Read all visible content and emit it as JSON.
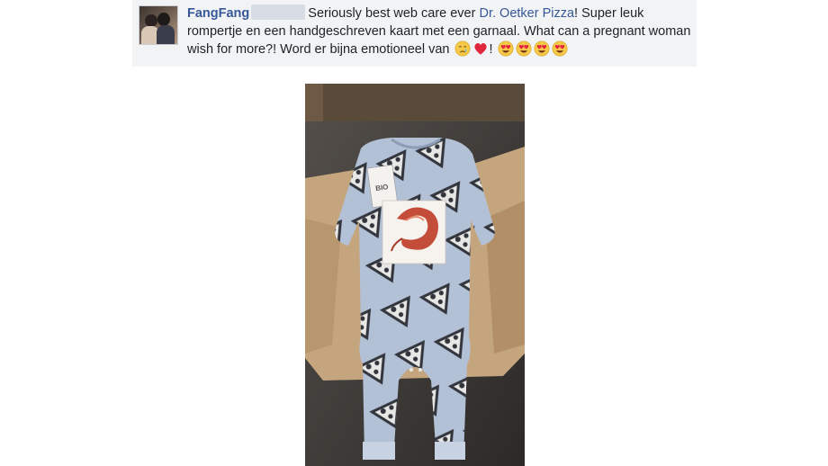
{
  "post": {
    "author": "FangFang",
    "text_before_mention": "Seriously best web care ever ",
    "mention": "Dr. Oetker Pizza",
    "text_after_mention": "! Super leuk rompertje en een handgeschreven kaart met een garnaal. What can a pregnant woman wish for more?! Word er bijna emotioneel van ",
    "text_after_emojis": "! ",
    "emojis": [
      "crying-face",
      "red-heart",
      "heart-eyes-face",
      "heart-eyes-face",
      "heart-eyes-face",
      "heart-eyes-face"
    ]
  },
  "photo": {
    "tag_text": "BIO"
  },
  "colors": {
    "link": "#365899",
    "post_background": "#f2f3f5",
    "text": "#1d2129"
  }
}
